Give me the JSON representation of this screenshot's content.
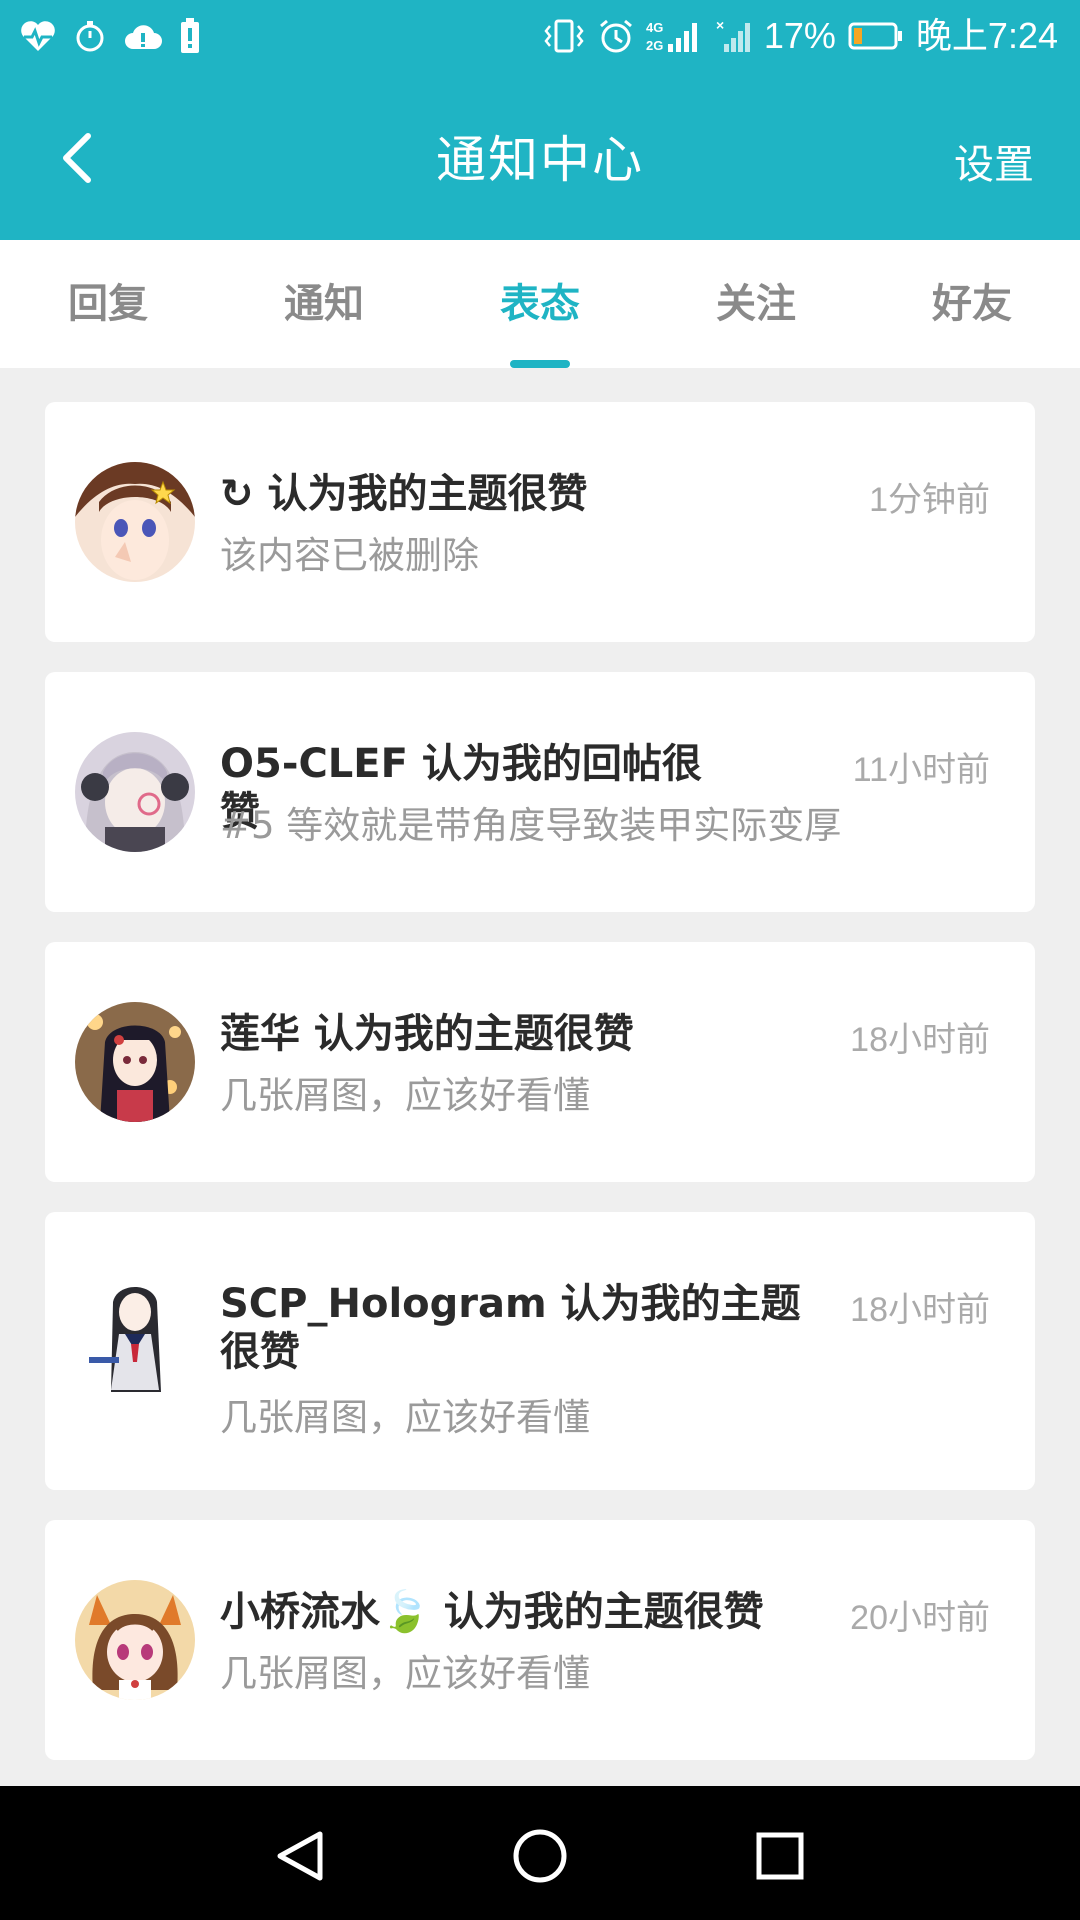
{
  "status_bar": {
    "battery_percent": "17%",
    "time": "晚上7:24",
    "network": "4G 2G"
  },
  "header": {
    "title": "通知中心",
    "settings_label": "设置"
  },
  "tabs": [
    {
      "label": "回复",
      "active": false
    },
    {
      "label": "通知",
      "active": false
    },
    {
      "label": "表态",
      "active": true
    },
    {
      "label": "关注",
      "active": false
    },
    {
      "label": "好友",
      "active": false
    }
  ],
  "notifications": [
    {
      "prefix_icon": "↻",
      "title": "认为我的主题很赞",
      "time": "1分钟前",
      "snippet": "该内容已被删除"
    },
    {
      "title": "O5-CLEF 认为我的回帖很赞",
      "time": "11小时前",
      "snippet": "#5 等效就是带角度导致装甲实际变厚"
    },
    {
      "title": "莲华 认为我的主题很赞",
      "time": "18小时前",
      "snippet": "几张屑图，应该好看懂"
    },
    {
      "title": "SCP_Hologram 认为我的主题很赞",
      "time": "18小时前",
      "snippet": "几张屑图，应该好看懂"
    },
    {
      "title": "小桥流水🍃 认为我的主题很赞",
      "time": "20小时前",
      "snippet": "几张屑图，应该好看懂"
    }
  ],
  "colors": {
    "accent": "#1fb4c4",
    "tab_inactive": "#8a8a8a",
    "background": "#efefef"
  }
}
